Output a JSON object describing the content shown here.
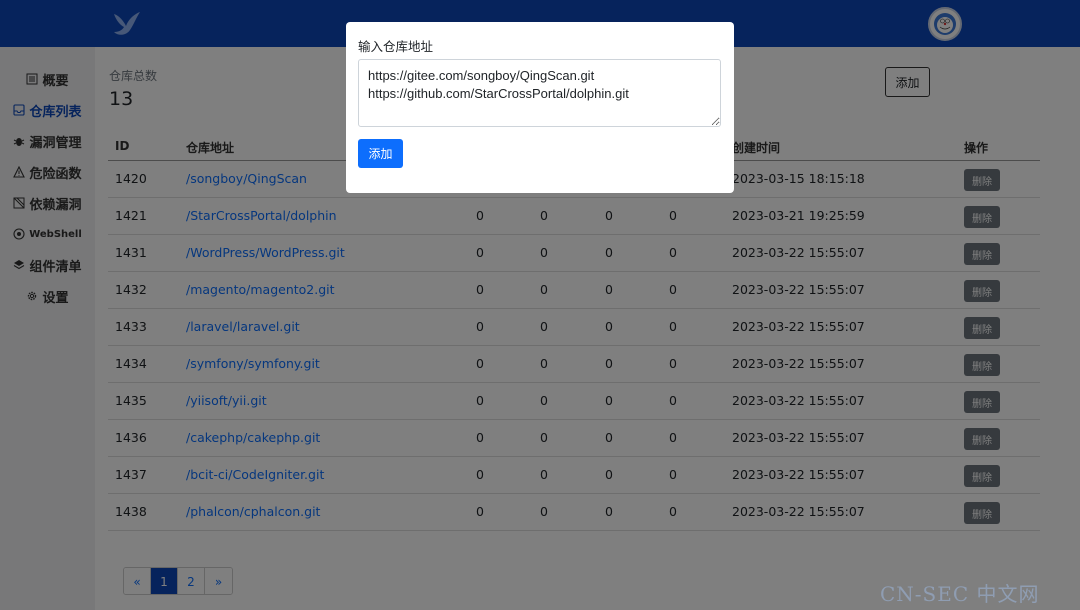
{
  "header": {
    "avatar_icon": "avatar-icon",
    "logo_icon": "bird-logo-icon"
  },
  "sidebar": {
    "items": [
      {
        "label": "概要",
        "icon": "list-icon"
      },
      {
        "label": "仓库列表",
        "icon": "inbox-icon",
        "active": true
      },
      {
        "label": "漏洞管理",
        "icon": "bug-icon"
      },
      {
        "label": "危险函数",
        "icon": "warning-icon"
      },
      {
        "label": "依赖漏洞",
        "icon": "dependency-icon"
      },
      {
        "label": "WebShell",
        "icon": "webshell-icon"
      },
      {
        "label": "组件清单",
        "icon": "layers-icon"
      },
      {
        "label": "设置",
        "icon": "gear-icon"
      }
    ]
  },
  "stats": {
    "label": "仓库总数",
    "value": "13"
  },
  "main": {
    "add_label": "添加"
  },
  "table": {
    "headers": {
      "id": "ID",
      "repo": "仓库地址",
      "created": "创建时间",
      "action": "操作"
    },
    "delete_label": "删除",
    "rows": [
      {
        "id": "1420",
        "repo": "/songboy/QingScan",
        "c1": "",
        "c2": "",
        "c3": "",
        "c4": "",
        "created": "2023-03-15 18:15:18"
      },
      {
        "id": "1421",
        "repo": "/StarCrossPortal/dolphin",
        "c1": "0",
        "c2": "0",
        "c3": "0",
        "c4": "0",
        "created": "2023-03-21 19:25:59"
      },
      {
        "id": "1431",
        "repo": "/WordPress/WordPress.git",
        "c1": "0",
        "c2": "0",
        "c3": "0",
        "c4": "0",
        "created": "2023-03-22 15:55:07"
      },
      {
        "id": "1432",
        "repo": "/magento/magento2.git",
        "c1": "0",
        "c2": "0",
        "c3": "0",
        "c4": "0",
        "created": "2023-03-22 15:55:07"
      },
      {
        "id": "1433",
        "repo": "/laravel/laravel.git",
        "c1": "0",
        "c2": "0",
        "c3": "0",
        "c4": "0",
        "created": "2023-03-22 15:55:07"
      },
      {
        "id": "1434",
        "repo": "/symfony/symfony.git",
        "c1": "0",
        "c2": "0",
        "c3": "0",
        "c4": "0",
        "created": "2023-03-22 15:55:07"
      },
      {
        "id": "1435",
        "repo": "/yiisoft/yii.git",
        "c1": "0",
        "c2": "0",
        "c3": "0",
        "c4": "0",
        "created": "2023-03-22 15:55:07"
      },
      {
        "id": "1436",
        "repo": "/cakephp/cakephp.git",
        "c1": "0",
        "c2": "0",
        "c3": "0",
        "c4": "0",
        "created": "2023-03-22 15:55:07"
      },
      {
        "id": "1437",
        "repo": "/bcit-ci/CodeIgniter.git",
        "c1": "0",
        "c2": "0",
        "c3": "0",
        "c4": "0",
        "created": "2023-03-22 15:55:07"
      },
      {
        "id": "1438",
        "repo": "/phalcon/cphalcon.git",
        "c1": "0",
        "c2": "0",
        "c3": "0",
        "c4": "0",
        "created": "2023-03-22 15:55:07"
      }
    ]
  },
  "pagination": {
    "prev": "«",
    "pages": [
      "1",
      "2"
    ],
    "next": "»",
    "current": "1"
  },
  "modal": {
    "title": "输入仓库地址",
    "textarea_value": "https://gitee.com/songboy/QingScan.git\nhttps://github.com/StarCrossPortal/dolphin.git",
    "add_label": "添加"
  },
  "watermark": "CN-SEC 中文网",
  "colors": {
    "header_bg": "#0d47b8",
    "primary": "#0d6efd",
    "delete_btn": "#6c757d"
  }
}
